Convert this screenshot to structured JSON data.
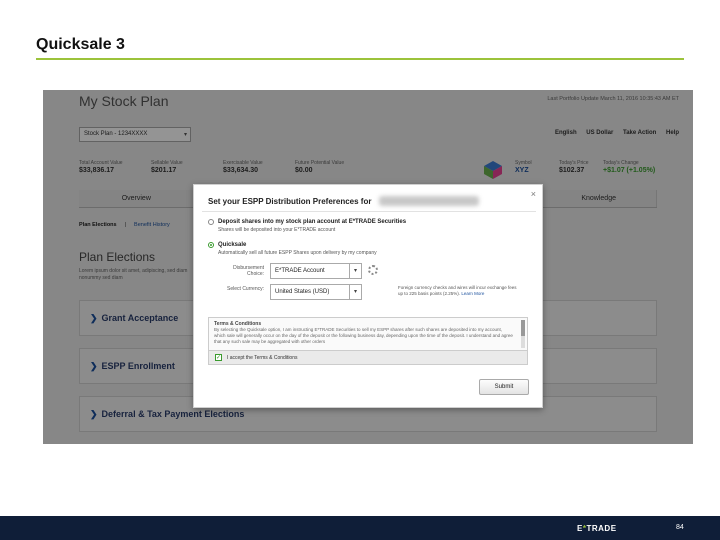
{
  "slide": {
    "title": "Quicksale 3",
    "brand_prefix": "E",
    "brand_star": "*",
    "brand_suffix": "TRADE",
    "page_number": "84",
    "colors": {
      "accent_green": "#9cc33b",
      "footer_navy": "#0f1e38"
    }
  },
  "app": {
    "page_title": "My Stock Plan",
    "last_login": "Last Portfolio Update March 11, 2016 10:35:43 AM ET",
    "plan_select_value": "Stock Plan - 1234XXXX",
    "menu": {
      "language": "English",
      "currency": "US Dollar",
      "take_action": "Take Action",
      "help": "Help"
    },
    "stats": [
      {
        "label": "Total Account Value",
        "value": "$33,836.17"
      },
      {
        "label": "Sellable Value",
        "value": "$201.17"
      },
      {
        "label": "Exercisable Value",
        "value": "$33,634.30"
      },
      {
        "label": "Future Potential Value",
        "value": "$0.00"
      }
    ],
    "ticker": [
      {
        "label": "Symbol",
        "value": "XYZ"
      },
      {
        "label": "Today's Price",
        "value": "$102.37"
      },
      {
        "label": "Today's Change",
        "value": "+$1.07 (+1.05%)"
      }
    ],
    "tabs": [
      "Overview",
      "",
      "",
      "",
      "Knowledge"
    ],
    "subnav": {
      "active": "Plan Elections",
      "separator": "|",
      "other": "Benefit History"
    },
    "section_title": "Plan Elections",
    "section_desc": "Lorem ipsum dolor sit amet, adipiscing, sed diam nonummy sed diam",
    "accordions": [
      "Grant Acceptance",
      "ESPP Enrollment",
      "Deferral & Tax Payment Elections"
    ]
  },
  "modal": {
    "title": "Set your ESPP Distribution Preferences for",
    "close": "×",
    "option_deposit": {
      "title": "Deposit shares into my stock plan account at E*TRADE Securities",
      "desc": "Shares will be deposited into your E*TRADE account",
      "selected": false
    },
    "option_quicksale": {
      "title": "Quicksale",
      "desc": "Automatically sell all future ESPP Shares upon delivery by my company",
      "selected": true
    },
    "disbursement": {
      "label": "Disbursement Choice:",
      "value": "E*TRADE Account"
    },
    "currency": {
      "label": "Select Currency:",
      "value": "United States (USD)"
    },
    "fx_note": "Foreign currency checks and wires will incur exchange fees up to 225 basis points (2.25%).",
    "fx_link": "Learn More",
    "terms": {
      "title": "Terms & Conditions",
      "text": "By selecting the Quicksale option, I am instructing E*TRADE Securities to sell my ESPP shares after such shares are deposited into my account, which sale will generally occur on the day of the deposit or the following business day, depending upon the time of the deposit. I understand and agree that any such sale may be aggregated with other orders"
    },
    "accept_label": "I accept the Terms & Conditions",
    "accept_checked": true,
    "submit_label": "Submit"
  }
}
